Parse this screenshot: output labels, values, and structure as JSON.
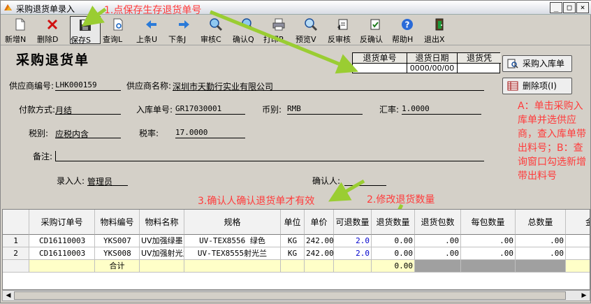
{
  "window": {
    "title": "采购退货单录入"
  },
  "toolbar": [
    {
      "label": "新增N",
      "icon": "new-doc-icon"
    },
    {
      "label": "删除D",
      "icon": "delete-x-icon"
    },
    {
      "label": "保存S",
      "icon": "save-icon"
    },
    {
      "label": "查询L",
      "icon": "query-icon"
    },
    {
      "label": "上条U",
      "icon": "arrow-left-icon"
    },
    {
      "label": "下条J",
      "icon": "arrow-right-icon"
    },
    {
      "label": "审核C",
      "icon": "audit-magnifier-icon"
    },
    {
      "label": "确认Q",
      "icon": "confirm-magnifier-icon"
    },
    {
      "label": "打印P",
      "icon": "printer-icon"
    },
    {
      "label": "预览V",
      "icon": "preview-icon"
    },
    {
      "label": "反审核",
      "icon": "reverse-audit-icon"
    },
    {
      "label": "反确认",
      "icon": "reverse-confirm-icon"
    },
    {
      "label": "帮助H",
      "icon": "help-icon"
    },
    {
      "label": "退出X",
      "icon": "exit-door-icon"
    }
  ],
  "form": {
    "title": "采购退货单",
    "supplier_code_label": "供应商编号:",
    "supplier_code": "LHK000159",
    "supplier_name_label": "供应商名称:",
    "supplier_name": "深圳市天勤行实业有限公司",
    "payment_label": "付款方式:",
    "payment": "月结",
    "inbound_no_label": "入库单号:",
    "inbound_no": "GR17030001",
    "currency_label": "币别:",
    "currency": "RMB",
    "rate_label": "汇率:",
    "rate": "1.0000",
    "tax_type_label": "税别:",
    "tax_type": "应税内含",
    "tax_rate_label": "税率:",
    "tax_rate": "17.0000",
    "remark_label": "备注:",
    "entered_by_label": "录入人:",
    "entered_by": "管理员",
    "confirmed_by_label": "确认人:",
    "confirmed_by": ""
  },
  "return_grid": {
    "headers": [
      "退货单号",
      "退货日期",
      "退货凭"
    ],
    "values": [
      "",
      "0000/00/00",
      ""
    ]
  },
  "buttons": {
    "purchase_inbound": "采购入库单",
    "delete_item": "删除项(I)"
  },
  "annotations": {
    "save": "1.点保存生存退货单号",
    "quantity": "2.修改退货数量",
    "confirm": "3.确认人确认退货单才有效",
    "side": "A：单击采购入库单并选供应商，查入库单带出料号；B：查询窗口勾选新增带出料号"
  },
  "detail": {
    "headers": [
      "",
      "采购订单号",
      "物料编号",
      "物料名称",
      "规格",
      "单位",
      "单价",
      "可退数量",
      "退货数量",
      "退货包数",
      "每包数量",
      "总数量",
      "金"
    ],
    "rows": [
      [
        "1",
        "CD16110003",
        "YKS007",
        "UV加强绿墨",
        "UV-TEX8556 绿色",
        "KG",
        "242.00",
        "2.0",
        "0.00",
        ".00",
        ".00",
        ".00",
        ""
      ],
      [
        "2",
        "CD16110003",
        "YKS008",
        "UV加强射光兰",
        "UV-TEX8555射光兰",
        "KG",
        "242.00",
        "2.0",
        "0.00",
        ".00",
        ".00",
        ".00",
        ""
      ]
    ],
    "sum_label": "合计",
    "sum_qty": "0.00"
  },
  "colors": {
    "annotation": "#ff3b3b",
    "arrow": "#9acd32",
    "sum_row": "#ffffc8"
  }
}
